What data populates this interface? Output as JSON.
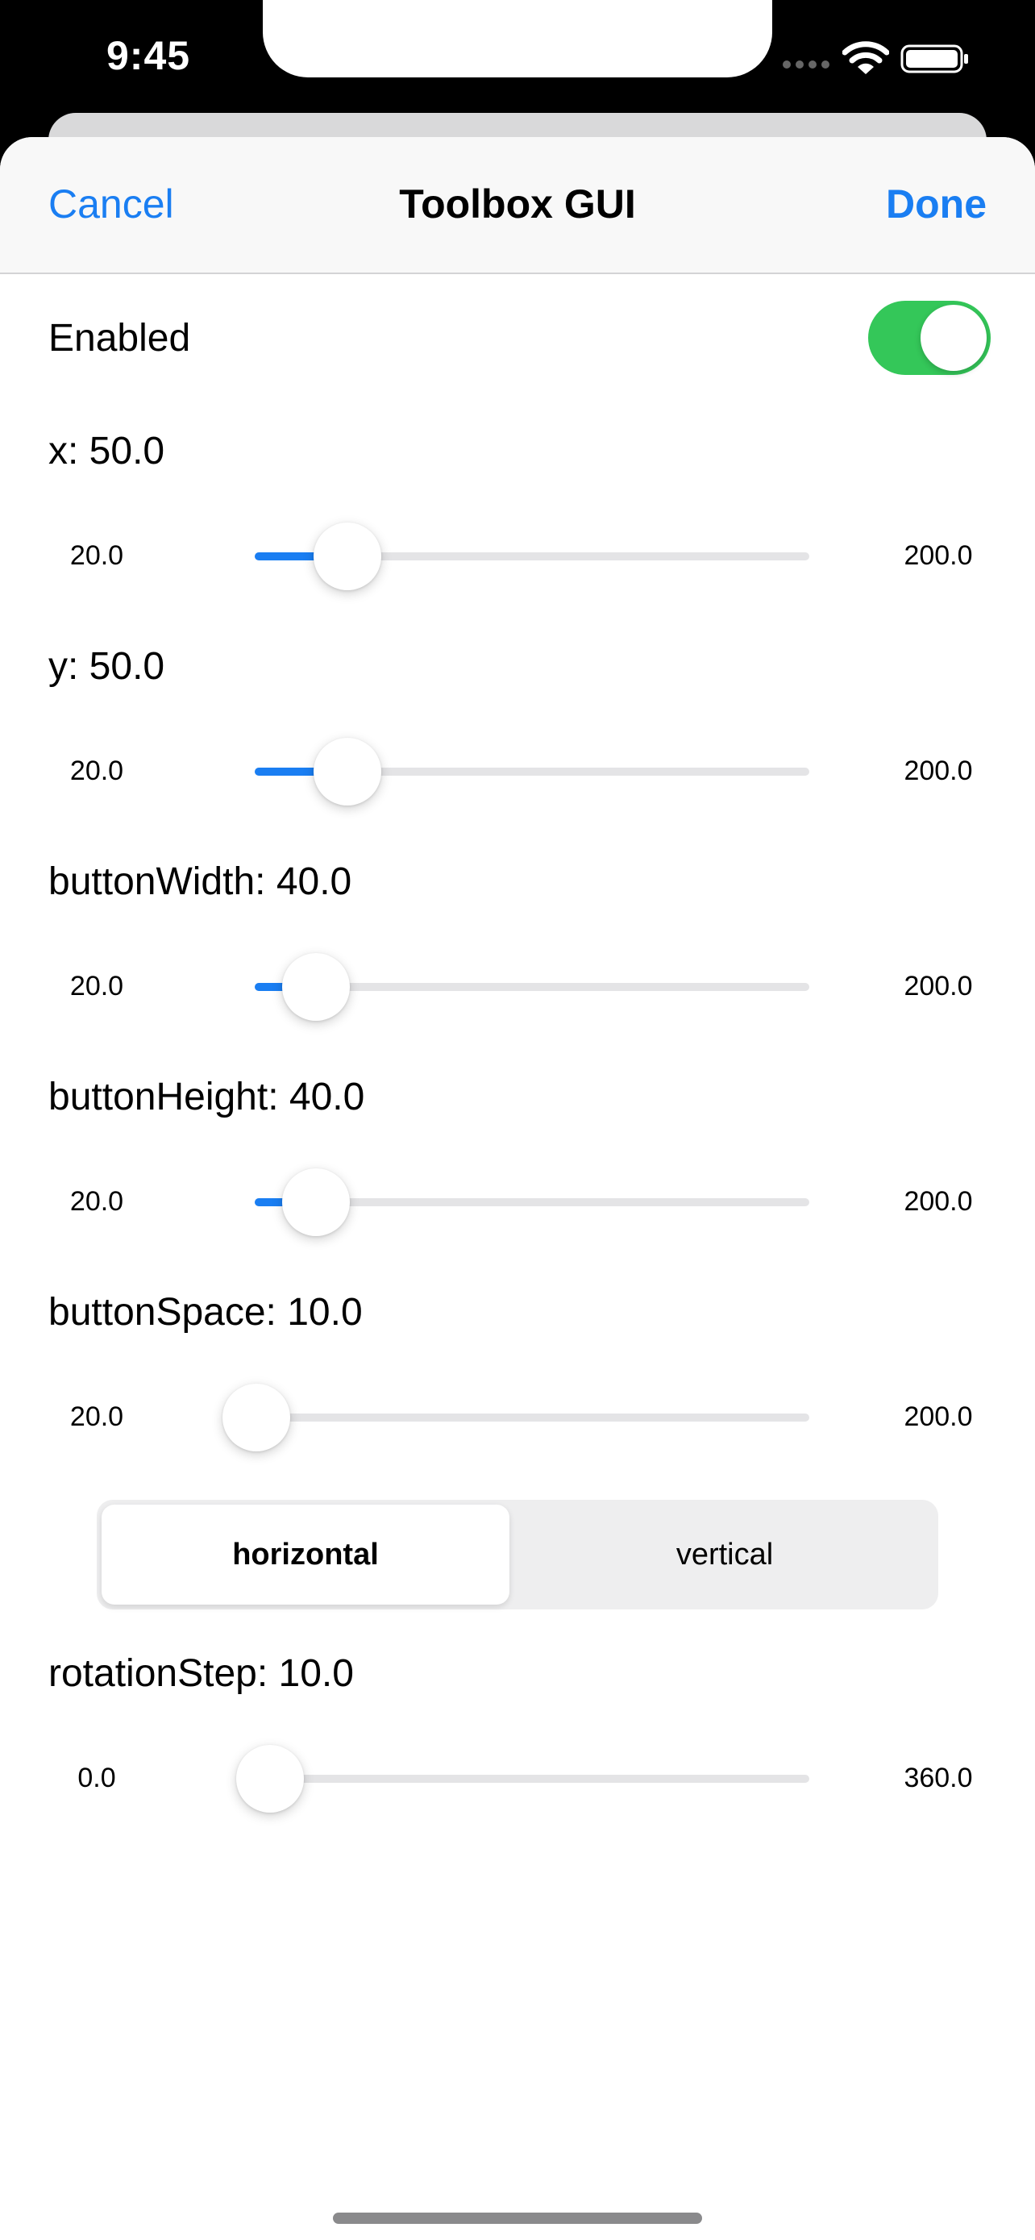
{
  "status_bar": {
    "time": "9:45"
  },
  "icons": {
    "signal": "cellular-signal-icon",
    "wifi": "wifi-icon",
    "battery": "battery-icon"
  },
  "nav": {
    "cancel_label": "Cancel",
    "title": "Toolbox GUI",
    "done_label": "Done"
  },
  "enabled": {
    "label": "Enabled",
    "value": true
  },
  "sliders": [
    {
      "label": "x: 50.0",
      "min": "20.0",
      "max": "200.0",
      "value": 50.0
    },
    {
      "label": "y: 50.0",
      "min": "20.0",
      "max": "200.0",
      "value": 50.0
    },
    {
      "label": "buttonWidth: 40.0",
      "min": "20.0",
      "max": "200.0",
      "value": 40.0
    },
    {
      "label": "buttonHeight: 40.0",
      "min": "20.0",
      "max": "200.0",
      "value": 40.0
    },
    {
      "label": "buttonSpace: 10.0",
      "min": "20.0",
      "max": "200.0",
      "value": 10.0
    }
  ],
  "orientation": {
    "options": [
      "horizontal",
      "vertical"
    ],
    "selected": "horizontal"
  },
  "rotation_slider": {
    "label": "rotationStep: 10.0",
    "min": "0.0",
    "max": "360.0",
    "value": 10.0
  },
  "colors": {
    "accent": "#1a7ef2",
    "toggle_on": "#34c759",
    "track": "#e4e4e6"
  }
}
